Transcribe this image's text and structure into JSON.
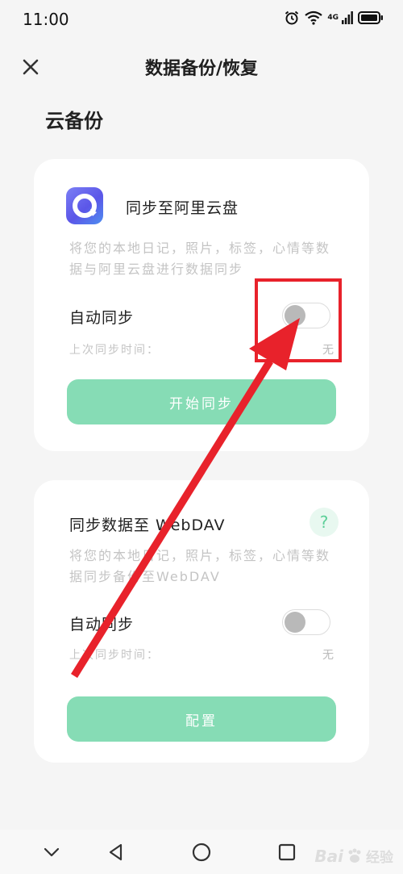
{
  "status_bar": {
    "time": "11:00",
    "network_label": "4G",
    "icons": [
      "alarm-icon",
      "wifi-icon",
      "signal-icon",
      "battery-icon"
    ]
  },
  "header": {
    "title": "数据备份/恢复",
    "close_icon": "close-icon"
  },
  "section": {
    "title": "云备份"
  },
  "aliyun_card": {
    "icon": "aliyun-drive-icon",
    "title": "同步至阿里云盘",
    "description": "将您的本地日记，照片，标签，心情等数据与阿里云盘进行数据同步",
    "auto_sync_label": "自动同步",
    "auto_sync_on": false,
    "last_sync_label": "上次同步时间：",
    "last_sync_value": "无",
    "button_label": "开始同步"
  },
  "webdav_card": {
    "title": "同步数据至 WebDAV",
    "help_symbol": "?",
    "description": "将您的本地日记，照片，标签，心情等数据同步备份至WebDAV",
    "auto_sync_label": "自动同步",
    "auto_sync_on": false,
    "last_sync_label": "上次同步时间：",
    "last_sync_value": "无",
    "button_label": "配置"
  },
  "nav_bar": {
    "icons": [
      "chevron-down-icon",
      "back-icon",
      "home-icon",
      "recents-icon"
    ]
  },
  "watermark": {
    "brand": "Bai",
    "suffix": "经验"
  },
  "colors": {
    "accent_green": "#86dcb5",
    "annotation_red": "#e8222b",
    "help_green": "#5ccf98"
  }
}
